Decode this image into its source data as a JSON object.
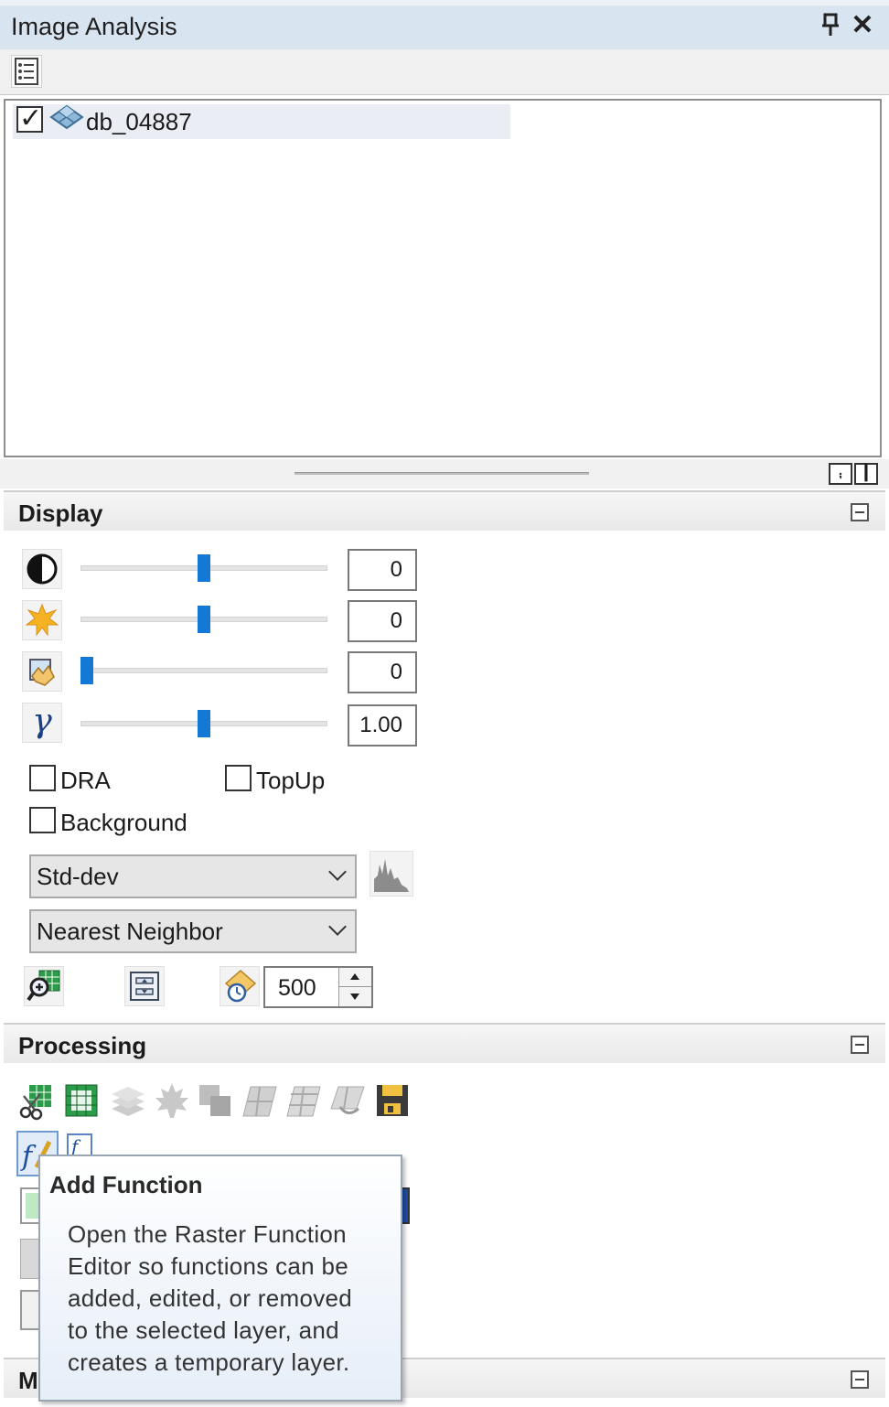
{
  "window": {
    "title": "Image Analysis",
    "pin_glyph": "Ⅰ",
    "close_glyph": "✕"
  },
  "layers": [
    {
      "name": "db_04887",
      "checked": true
    }
  ],
  "display": {
    "title": "Display",
    "sliders": [
      {
        "icon": "contrast-icon",
        "value": "0",
        "level": 0.5
      },
      {
        "icon": "brightness-icon",
        "value": "0",
        "level": 0.5
      },
      {
        "icon": "transparency-icon",
        "value": "0",
        "level": 0.0
      },
      {
        "icon": "gamma-icon",
        "value": "1.00",
        "level": 0.5
      }
    ],
    "gamma_glyph": "γ",
    "checkboxes": {
      "dra": "DRA",
      "topup": "TopUp",
      "background": "Background"
    },
    "stretch_select": "Std-dev",
    "resample_select": "Nearest Neighbor",
    "refresh_value": "500"
  },
  "processing": {
    "title": "Processing"
  },
  "third_section": {
    "title_visible": "M"
  },
  "tooltip": {
    "title": "Add Function",
    "lines": [
      "Open the Raster Function",
      "Editor so functions can be",
      "added, edited, or removed",
      "to the selected layer, and",
      "creates a temporary layer."
    ]
  },
  "colors": {
    "accent": "#1479d6",
    "header_bg": "#d9e4f1"
  }
}
